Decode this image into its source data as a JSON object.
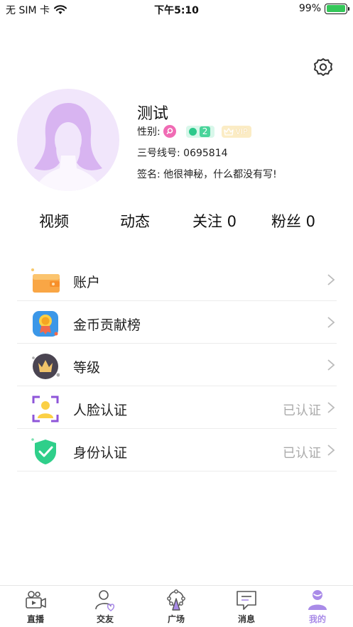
{
  "status_bar": {
    "carrier": "无 SIM 卡",
    "time": "下午5:10",
    "battery": "99%",
    "battery_level": 0.99
  },
  "profile": {
    "name": "测试",
    "gender_label": "性别:",
    "level": "2",
    "vip": "VIP",
    "phone_label": "三号线号:",
    "phone_value": "0695814",
    "sign_label": "签名:",
    "sign_value": "他很神秘，什么都没有写!"
  },
  "stats": {
    "video": "视频",
    "moments": "动态",
    "follow": "关注 0",
    "fans": "粉丝 0"
  },
  "menu": {
    "items": [
      {
        "label": "账户",
        "status": "",
        "icon": "wallet-icon"
      },
      {
        "label": "金币贡献榜",
        "status": "",
        "icon": "medal-icon"
      },
      {
        "label": "等级",
        "status": "",
        "icon": "crown-icon"
      },
      {
        "label": "人脸认证",
        "status": "已认证",
        "icon": "face-scan-icon"
      },
      {
        "label": "身份认证",
        "status": "已认证",
        "icon": "shield-check-icon"
      }
    ]
  },
  "tab_bar": {
    "items": [
      {
        "label": "直播",
        "icon": "live-camera-icon"
      },
      {
        "label": "交友",
        "icon": "friends-icon"
      },
      {
        "label": "广场",
        "icon": "ferris-wheel-icon"
      },
      {
        "label": "消息",
        "icon": "message-icon"
      },
      {
        "label": "我的",
        "icon": "profile-icon"
      }
    ],
    "active": "我的"
  },
  "colors": {
    "accent": "#a98be8",
    "avatar_bg": "#f1e6fb",
    "verified_text": "#aaaaaa"
  }
}
